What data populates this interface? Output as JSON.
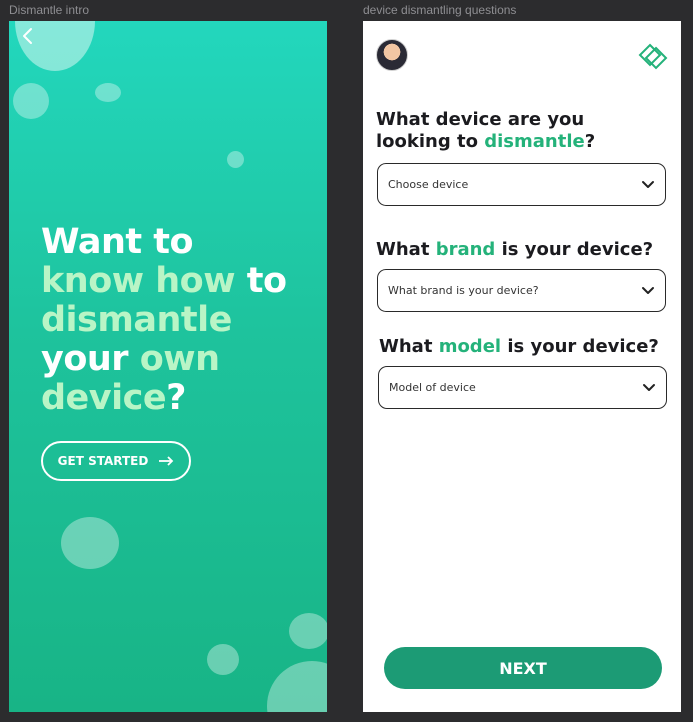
{
  "frames": {
    "intro_label": "Dismantle intro",
    "questions_label": "device dismantling questions"
  },
  "intro": {
    "back_icon": "chevron-left-icon",
    "headline": {
      "l1": "Want to",
      "l2a": "know how",
      "l2b": " to",
      "l3": "dismantle",
      "l4a": "your ",
      "l4b": "own",
      "l5a": "device",
      "l5b": "?"
    },
    "cta_label": "GET STARTED",
    "cta_icon": "arrow-right-icon"
  },
  "questions": {
    "avatar": "user-avatar",
    "logo_icon": "diamond-logo-icon",
    "q1": {
      "a": "What device are you",
      "b": "looking to ",
      "c": "dismantle",
      "d": "?",
      "placeholder": "Choose device"
    },
    "q2": {
      "a": "What ",
      "b": "brand",
      "c": " is your device?",
      "placeholder": "What brand is your device?"
    },
    "q3": {
      "a": "What ",
      "b": "model",
      "c": " is your device?",
      "placeholder": "Model of device"
    },
    "next_label": "NEXT"
  },
  "colors": {
    "intro_gradient_top": "#23d7bd",
    "intro_gradient_bottom": "#18b486",
    "highlight_green": "#b9f5c6",
    "accent_green": "#24b27a",
    "button_green": "#1c9b75"
  }
}
